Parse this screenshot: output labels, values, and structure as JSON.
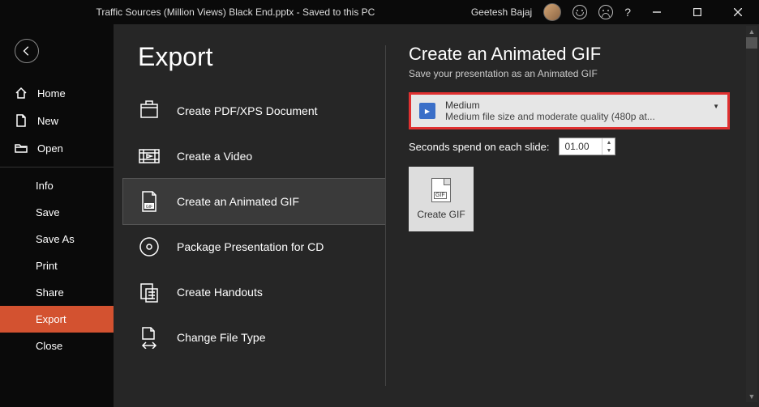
{
  "titlebar": {
    "document": "Traffic Sources (Million Views) Black End.pptx  -  Saved to this PC",
    "user": "Geetesh Bajaj"
  },
  "sidebar": {
    "home": "Home",
    "new": "New",
    "open": "Open",
    "info": "Info",
    "save": "Save",
    "save_as": "Save As",
    "print": "Print",
    "share": "Share",
    "export": "Export",
    "close": "Close"
  },
  "page": {
    "title": "Export"
  },
  "export_options": {
    "pdf": "Create PDF/XPS Document",
    "video": "Create a Video",
    "gif": "Create an Animated GIF",
    "package": "Package Presentation for CD",
    "handouts": "Create Handouts",
    "filetype": "Change File Type"
  },
  "detail": {
    "title": "Create an Animated GIF",
    "subtitle": "Save your presentation as an Animated GIF",
    "quality_name": "Medium",
    "quality_desc": "Medium file size and moderate quality (480p at...",
    "seconds_label": "Seconds spend on each slide:",
    "seconds_value": "01.00",
    "create_label": "Create GIF",
    "file_badge": "GIF",
    "icon_badge": "▶"
  }
}
